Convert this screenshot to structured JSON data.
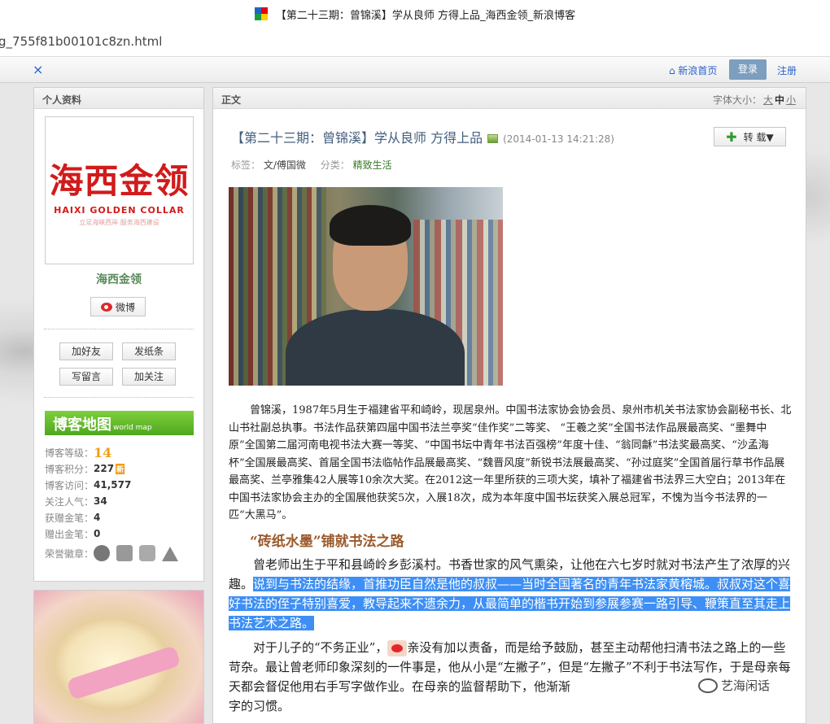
{
  "browser": {
    "window_title": "【第二十三期：曾锦溪】学从良师 方得上品_海西金领_新浪博客",
    "url": "g_755f81b00101c8zn.html"
  },
  "topnav": {
    "close": "×",
    "home": "⌂ 新浪首页",
    "login": "登录",
    "register": "注册"
  },
  "profile": {
    "header": "个人资料",
    "avatar_text": "海西金领",
    "avatar_sub": "HAIXI GOLDEN COLLAR",
    "avatar_tagline": "立足海峡西岸    服务海西建设",
    "name": "海西金领",
    "weibo": "微博",
    "buttons": [
      "加好友",
      "发纸条",
      "写留言",
      "加关注"
    ],
    "blogmap_title": "博客地图",
    "blogmap_sub": "world map",
    "stats": [
      {
        "k": "博客等级：",
        "v": "14"
      },
      {
        "k": "博客积分：",
        "v": "227"
      },
      {
        "k": "博客访问：",
        "v": "41,577"
      },
      {
        "k": "关注人气：",
        "v": "34"
      },
      {
        "k": "获赠金笔：",
        "v": "4"
      },
      {
        "k": "赠出金笔：",
        "v": "0"
      },
      {
        "k": "荣誉徽章：",
        "v": ""
      }
    ],
    "new_badge": "新"
  },
  "main": {
    "header": "正文",
    "font_size_label": "字体大小：",
    "font_big": "大",
    "font_mid": "中",
    "font_small": "小",
    "title": "【第二十三期：曾锦溪】学从良师 方得上品",
    "date": "(2014-01-13 14:21:28)",
    "repost": "转 载▼",
    "tags_label": "标签：",
    "tag": "文/傅国微",
    "category_label": "分类：",
    "category": "精致生活",
    "para1": "曾锦溪，1987年5月生于福建省平和崎岭，现居泉州。中国书法家协会协会员、泉州市机关书法家协会副秘书长、北山书社副总执事。书法作品获第四届中国书法兰亭奖“佳作奖”二等奖、 “王羲之奖”全国书法作品展最高奖、“墨舞中原”全国第二届河南电视书法大赛一等奖、“中国书坛中青年书法百强榜”年度十佳、“翁同龢”书法奖最高奖、“沙孟海杯”全国展最高奖、首届全国书法临帖作品展最高奖、“魏晋风度”新锐书法展最高奖、“孙过庭奖”全国首届行草书作品展最高奖、兰亭雅集42人展等10余次大奖。在2012这一年里所获的三项大奖，填补了福建省书法界三大空白；2013年在中国书法家协会主办的全国展他获奖5次，入展18次，成为本年度中国书坛获奖入展总冠军，不愧为当今书法界的一匹“大黑马”。",
    "subhead": "“砖纸水墨”铺就书法之路",
    "para2_a": "曾老师出生于平和县崎岭乡彭溪村。书香世家的风气熏染，让他在六七岁时就对书法产生了浓厚的兴趣。",
    "para2_b": "说到与书法的结缘，首推功臣自然是他的叔叔——当时全国著名的青年书法家黄榕城。叔叔对这个喜好书法的侄子特别喜爱，教导起来不遗余力，从最简单的楷书开始到参展参赛一路引导、鞭策直至其走上书法艺术之路。",
    "para3_a": "对于儿子的“不务正业”，",
    "para3_b": "亲没有加以责备，而是给予鼓励，甚至主动帮他扫清书法之路上的一些苛杂。最让曾老师印象深刻的一件事是，他从小是“左撇子”，但是“左撇子”不利于书法写作，于是母亲每天都会督促他用右手写字做作业。在母亲的监督帮助下，他渐渐",
    "para3_c": "字的习惯。"
  },
  "watermark": "艺海闲话"
}
